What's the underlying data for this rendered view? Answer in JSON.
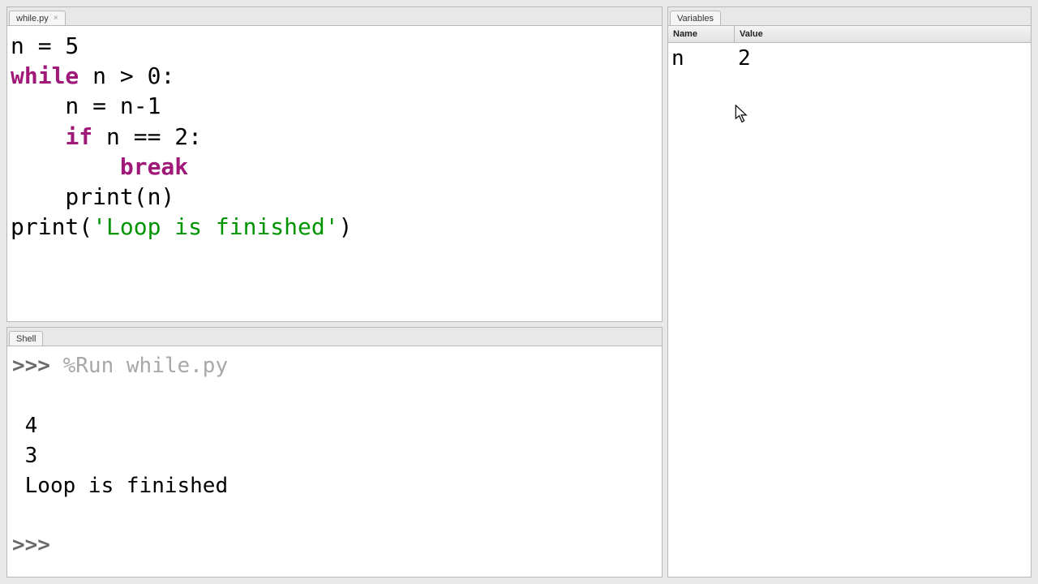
{
  "editor": {
    "tab_label": "while.py",
    "code": {
      "l1_plain": "n = 5",
      "l2_kw": "while",
      "l2_rest": " n > 0:",
      "l3": "    n = n-1",
      "l4_indent": "    ",
      "l4_kw": "if",
      "l4_rest": " n == 2:",
      "l5_indent": "        ",
      "l5_kw": "break",
      "l6": "    print(n)",
      "l7_a": "print(",
      "l7_str": "'Loop is finished'",
      "l7_b": ")"
    }
  },
  "shell": {
    "tab_label": "Shell",
    "prompt": ">>> ",
    "run_cmd": "%Run while.py",
    "out1": "4",
    "out2": "3",
    "out3": "Loop is finished",
    "prompt2": ">>> "
  },
  "variables": {
    "tab_label": "Variables",
    "col_name": "Name",
    "col_value": "Value",
    "rows": [
      {
        "name": "n",
        "value": "2"
      }
    ]
  }
}
